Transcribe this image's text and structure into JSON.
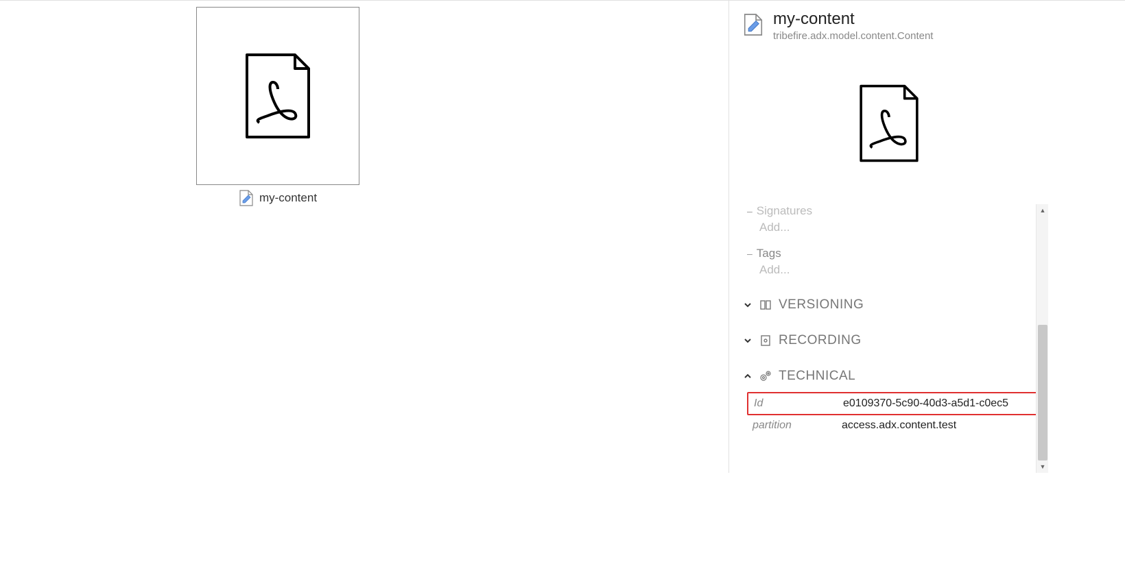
{
  "main": {
    "thumbnail": {
      "label": "my-content"
    }
  },
  "panel": {
    "title": "my-content",
    "subtitle": "tribefire.adx.model.content.Content",
    "fields": {
      "signatures": {
        "label": "Signatures",
        "add_label": "Add..."
      },
      "tags": {
        "label": "Tags",
        "add_label": "Add..."
      }
    },
    "sections": {
      "versioning": {
        "title": "VERSIONING",
        "expanded": false
      },
      "recording": {
        "title": "RECORDING",
        "expanded": false
      },
      "technical": {
        "title": "TECHNICAL",
        "expanded": true,
        "rows": [
          {
            "key": "Id",
            "value": "e0109370-5c90-40d3-a5d1-c0ec5"
          },
          {
            "key": "partition",
            "value": "access.adx.content.test"
          }
        ]
      }
    }
  }
}
